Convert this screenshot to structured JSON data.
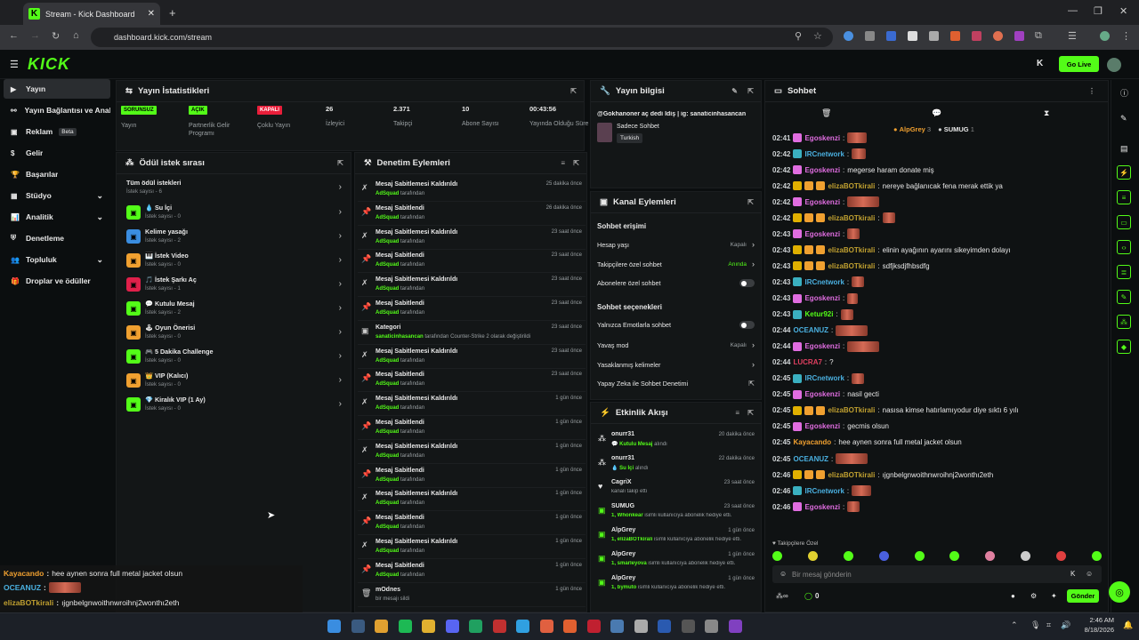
{
  "browser": {
    "tab_title": "Stream - Kick Dashboard",
    "url": "dashboard.kick.com/stream"
  },
  "brand": {
    "logo": "KICK",
    "accent": "#53fc18"
  },
  "topnav": {
    "go_live": "Go Live"
  },
  "sidebar": {
    "items": [
      {
        "label": "Yayın",
        "icon": "video-icon",
        "active": true
      },
      {
        "label": "Yayın Bağlantısı ve Anahtarı",
        "icon": "key-icon"
      },
      {
        "label": "Reklam",
        "icon": "ad-icon",
        "badge": "Beta"
      },
      {
        "label": "Gelir",
        "icon": "money-icon"
      },
      {
        "label": "Başarılar",
        "icon": "trophy-icon"
      },
      {
        "label": "Stüdyo",
        "icon": "studio-icon",
        "expand": true
      },
      {
        "label": "Analitik",
        "icon": "analytics-icon",
        "expand": true
      },
      {
        "label": "Denetleme",
        "icon": "shield-icon"
      },
      {
        "label": "Topluluk",
        "icon": "community-icon",
        "expand": true
      },
      {
        "label": "Droplar ve ödüller",
        "icon": "gift-icon"
      }
    ]
  },
  "stats": {
    "title": "Yayın İstatistikleri",
    "items": [
      {
        "value": "SORUNSUZ",
        "label": "Yayın",
        "kind": "badge-green"
      },
      {
        "value": "AÇIK",
        "label": "Partnerlik Gelir Programı",
        "kind": "badge-green"
      },
      {
        "value": "KAPALI",
        "label": "Çoklu Yayın",
        "kind": "badge-red"
      },
      {
        "value": "26",
        "label": "İzleyici"
      },
      {
        "value": "2.371",
        "label": "Takipçi"
      },
      {
        "value": "10",
        "label": "Abone Sayısı"
      },
      {
        "value": "00:43:56",
        "label": "Yayında Olduğu Süre"
      }
    ]
  },
  "rewards": {
    "title": "Ödül istek sırası",
    "items": [
      {
        "name": "Tüm ödül istekleri",
        "sub": "İstek sayısı - 6",
        "color": ""
      },
      {
        "name": "💧 Su İçi",
        "sub": "İstek sayısı - 0",
        "color": "#53fc18"
      },
      {
        "name": "Kelime yasağı",
        "sub": "İstek sayısı - 2",
        "color": "#3a8de0"
      },
      {
        "name": "🎹 İstek Video",
        "sub": "İstek sayısı - 0",
        "color": "#f0a030"
      },
      {
        "name": "🎵 İstek Şarkı Aç",
        "sub": "İstek sayısı - 1",
        "color": "#e0204a"
      },
      {
        "name": "💬 Kutulu Mesaj",
        "sub": "İstek sayısı - 2",
        "color": "#53fc18"
      },
      {
        "name": "🕹 Oyun Önerisi",
        "sub": "İstek sayısı - 0",
        "color": "#f0a030"
      },
      {
        "name": "🎮 5 Dakika Challenge",
        "sub": "İstek sayısı - 0",
        "color": "#53fc18"
      },
      {
        "name": "👑 VIP (Kalıcı)",
        "sub": "İstek sayısı - 0",
        "color": "#f0a030"
      },
      {
        "name": "💎 Kiralık VIP (1 Ay)",
        "sub": "İstek sayısı - 0",
        "color": "#53fc18"
      }
    ]
  },
  "moderation": {
    "title": "Denetim Eylemleri",
    "items": [
      {
        "title": "Mesaj Sabitlemesi Kaldırıldı",
        "actor": "AdSquad",
        "suffix": "tarafından",
        "time": "25 dakika önce",
        "icon": "unpin"
      },
      {
        "title": "Mesaj Sabitlendi",
        "actor": "AdSquad",
        "suffix": "tarafından",
        "time": "26 dakika önce",
        "icon": "pin"
      },
      {
        "title": "Mesaj Sabitlemesi Kaldırıldı",
        "actor": "AdSquad",
        "suffix": "tarafından",
        "time": "23 saat önce",
        "icon": "unpin"
      },
      {
        "title": "Mesaj Sabitlendi",
        "actor": "AdSquad",
        "suffix": "tarafından",
        "time": "23 saat önce",
        "icon": "pin"
      },
      {
        "title": "Mesaj Sabitlemesi Kaldırıldı",
        "actor": "AdSquad",
        "suffix": "tarafından",
        "time": "23 saat önce",
        "icon": "unpin"
      },
      {
        "title": "Mesaj Sabitlendi",
        "actor": "AdSquad",
        "suffix": "tarafından",
        "time": "23 saat önce",
        "icon": "pin"
      },
      {
        "title": "Kategori",
        "actor": "sanaticinhasancan",
        "suffix": "tarafından Counter-Strike 2 olarak değiştirildi",
        "time": "23 saat önce",
        "icon": "category"
      },
      {
        "title": "Mesaj Sabitlemesi Kaldırıldı",
        "actor": "AdSquad",
        "suffix": "tarafından",
        "time": "23 saat önce",
        "icon": "unpin"
      },
      {
        "title": "Mesaj Sabitlendi",
        "actor": "AdSquad",
        "suffix": "tarafından",
        "time": "23 saat önce",
        "icon": "pin"
      },
      {
        "title": "Mesaj Sabitlemesi Kaldırıldı",
        "actor": "AdSquad",
        "suffix": "tarafından",
        "time": "1 gün önce",
        "icon": "unpin"
      },
      {
        "title": "Mesaj Sabitlendi",
        "actor": "AdSquad",
        "suffix": "tarafından",
        "time": "1 gün önce",
        "icon": "pin"
      },
      {
        "title": "Mesaj Sabitlemesi Kaldırıldı",
        "actor": "AdSquad",
        "suffix": "tarafından",
        "time": "1 gün önce",
        "icon": "unpin"
      },
      {
        "title": "Mesaj Sabitlendi",
        "actor": "AdSquad",
        "suffix": "tarafından",
        "time": "1 gün önce",
        "icon": "pin"
      },
      {
        "title": "Mesaj Sabitlemesi Kaldırıldı",
        "actor": "AdSquad",
        "suffix": "tarafından",
        "time": "1 gün önce",
        "icon": "unpin"
      },
      {
        "title": "Mesaj Sabitlendi",
        "actor": "AdSquad",
        "suffix": "tarafından",
        "time": "1 gün önce",
        "icon": "pin"
      },
      {
        "title": "Mesaj Sabitlemesi Kaldırıldı",
        "actor": "AdSquad",
        "suffix": "tarafından",
        "time": "1 gün önce",
        "icon": "unpin"
      },
      {
        "title": "Mesaj Sabitlendi",
        "actor": "AdSquad",
        "suffix": "tarafından",
        "time": "1 gün önce",
        "icon": "pin"
      },
      {
        "title": "mOdnes",
        "actor": "",
        "suffix": "bir mesajı sildi",
        "time": "1 gün önce",
        "icon": "trash"
      }
    ]
  },
  "streaminfo": {
    "title": "Yayın bilgisi",
    "stream_title": "@Gokhanoner aç dedi İdiş | ig: sanaticinhasancan",
    "category": "Sadece Sohbet",
    "tag": "Turkish"
  },
  "channel": {
    "title": "Kanal Eylemleri",
    "sec1": "Sohbet erişimi",
    "rows1": [
      {
        "label": "Hesap yaşı",
        "value": "Kapalı",
        "kind": "chev"
      },
      {
        "label": "Takipçilere özel sohbet",
        "value": "Anında",
        "kind": "chev-green"
      },
      {
        "label": "Abonelere özel sohbet",
        "value": "",
        "kind": "toggle"
      }
    ],
    "sec2": "Sohbet seçenekleri",
    "rows2": [
      {
        "label": "Yalnızca Emotlarla sohbet",
        "value": "",
        "kind": "toggle"
      },
      {
        "label": "Yavaş mod",
        "value": "Kapalı",
        "kind": "chev"
      },
      {
        "label": "Yasaklanmış kelimeler",
        "value": "",
        "kind": "chev"
      },
      {
        "label": "Yapay Zeka ile Sohbet Denetimi",
        "value": "",
        "kind": "ext"
      }
    ]
  },
  "activity": {
    "title": "Etkinlik Akışı",
    "items": [
      {
        "user": "onurr31",
        "detail": "💬 Kutulu Mesaj",
        "detail2": "alındı",
        "time": "20 dakika önce",
        "icon": "reward"
      },
      {
        "user": "onurr31",
        "detail": "💧 Su İçi",
        "detail2": "alındı",
        "time": "22 dakika önce",
        "icon": "reward"
      },
      {
        "user": "CagriX",
        "detail": "",
        "detail2": "kanalı takip etti",
        "time": "23 saat önce",
        "icon": "heart"
      },
      {
        "user": "SUMUG",
        "detail": "1, Whonkear",
        "detail2": "isimli kullanıcıya abonelik hediye etti.",
        "time": "23 saat önce",
        "icon": "gift"
      },
      {
        "user": "AlpGrey",
        "detail": "1, elizaBOTkirali",
        "detail2": "isimli kullanıcıya abonelik hediye etti.",
        "time": "1 gün önce",
        "icon": "gift"
      },
      {
        "user": "AlpGrey",
        "detail": "1, smarleyova",
        "detail2": "isimli kullanıcıya abonelik hediye etti.",
        "time": "1 gün önce",
        "icon": "gift"
      },
      {
        "user": "AlpGrey",
        "detail": "1, bymuto",
        "detail2": "isimli kullanıcıya abonelik hediye etti.",
        "time": "1 gün önce",
        "icon": "gift"
      }
    ]
  },
  "chat": {
    "title": "Sohbet",
    "top_gifters": [
      {
        "name": "AlpGrey",
        "count": "3"
      },
      {
        "name": "SUMUG",
        "count": "1"
      }
    ],
    "messages": [
      {
        "time": "02:41",
        "user": "Egoskenzi",
        "color": "#e06de0",
        "text": "",
        "emote": 22,
        "badges": [
          "#e06de0"
        ]
      },
      {
        "time": "02:42",
        "user": "IRCnetwork",
        "color": "#4ab0e0",
        "text": "",
        "emote": 16,
        "badges": [
          "#3ab0c0"
        ]
      },
      {
        "time": "02:42",
        "user": "Egoskenzi",
        "color": "#e06de0",
        "text": "megerse haram donate miş",
        "emote": 0,
        "badges": [
          "#e06de0"
        ]
      },
      {
        "time": "02:42",
        "user": "elizaBOTkirali",
        "color": "#c0a030",
        "text": "nereye bağlanıcak fena merak ettik ya",
        "emote": 0,
        "badges": [
          "#e0b000",
          "#f0a030",
          "#f0a030"
        ]
      },
      {
        "time": "02:42",
        "user": "Egoskenzi",
        "color": "#e06de0",
        "text": "",
        "emote": 36,
        "badges": [
          "#e06de0"
        ]
      },
      {
        "time": "02:42",
        "user": "elizaBOTkirali",
        "color": "#c0a030",
        "text": "",
        "emote": 14,
        "badges": [
          "#e0b000",
          "#f0a030",
          "#f0a030"
        ]
      },
      {
        "time": "02:43",
        "user": "Egoskenzi",
        "color": "#e06de0",
        "text": "",
        "emote": 14,
        "badges": [
          "#e06de0"
        ]
      },
      {
        "time": "02:43",
        "user": "elizaBOTkirali",
        "color": "#c0a030",
        "text": "elinin ayağının ayarını sikeyimden dolayı",
        "emote": 0,
        "badges": [
          "#e0b000",
          "#f0a030",
          "#f0a030"
        ]
      },
      {
        "time": "02:43",
        "user": "elizaBOTkirali",
        "color": "#c0a030",
        "text": "sdfjksdjfhbsdfg",
        "emote": 0,
        "badges": [
          "#e0b000",
          "#f0a030",
          "#f0a030"
        ]
      },
      {
        "time": "02:43",
        "user": "IRCnetwork",
        "color": "#4ab0e0",
        "text": "",
        "emote": 14,
        "badges": [
          "#3ab0c0"
        ]
      },
      {
        "time": "02:43",
        "user": "Egoskenzi",
        "color": "#e06de0",
        "text": "",
        "emote": 12,
        "badges": [
          "#e06de0"
        ]
      },
      {
        "time": "02:43",
        "user": "Ketur92i",
        "color": "#53fc18",
        "text": "",
        "emote": 14,
        "badges": [
          "#3ab0c0"
        ]
      },
      {
        "time": "02:44",
        "user": "OCEANUZ",
        "color": "#4ab0e0",
        "text": "",
        "emote": 36,
        "badges": []
      },
      {
        "time": "02:44",
        "user": "Egoskenzi",
        "color": "#e06de0",
        "text": "",
        "emote": 36,
        "badges": [
          "#e06de0"
        ]
      },
      {
        "time": "02:44",
        "user": "LUCRA7",
        "color": "#e04060",
        "text": "?",
        "emote": 0,
        "badges": []
      },
      {
        "time": "02:45",
        "user": "IRCnetwork",
        "color": "#4ab0e0",
        "text": "",
        "emote": 14,
        "badges": [
          "#3ab0c0"
        ]
      },
      {
        "time": "02:45",
        "user": "Egoskenzi",
        "color": "#e06de0",
        "text": "nasil gecti",
        "emote": 0,
        "badges": [
          "#e06de0"
        ]
      },
      {
        "time": "02:45",
        "user": "elizaBOTkirali",
        "color": "#c0a030",
        "text": "nasısa kimse hatırlamıyodur diye sıktı 6 yılı",
        "emote": 0,
        "badges": [
          "#e0b000",
          "#f0a030",
          "#f0a030"
        ]
      },
      {
        "time": "02:45",
        "user": "Egoskenzi",
        "color": "#e06de0",
        "text": "gecmis olsun",
        "emote": 0,
        "badges": [
          "#e06de0"
        ]
      },
      {
        "time": "02:45",
        "user": "Kayacando",
        "color": "#f0a030",
        "text": "hee aynen sonra full metal jacket olsun",
        "emote": 0,
        "badges": []
      },
      {
        "time": "02:45",
        "user": "OCEANUZ",
        "color": "#4ab0e0",
        "text": "",
        "emote": 36,
        "badges": []
      },
      {
        "time": "02:46",
        "user": "elizaBOTkirali",
        "color": "#c0a030",
        "text": "ıjgnbelgnwoithnwroihnj2wonthı2eth",
        "emote": 0,
        "badges": [
          "#e0b000",
          "#f0a030",
          "#f0a030"
        ]
      },
      {
        "time": "02:46",
        "user": "IRCnetwork",
        "color": "#4ab0e0",
        "text": "",
        "emote": 22,
        "badges": [
          "#3ab0c0"
        ]
      },
      {
        "time": "02:46",
        "user": "Egoskenzi",
        "color": "#e06de0",
        "text": "",
        "emote": 14,
        "badges": [
          "#e06de0"
        ]
      }
    ],
    "followers_only": "Takipçilere Özel",
    "placeholder": "Bir mesaj gönderin",
    "send": "Gönder",
    "viewers": "0"
  },
  "overlay": [
    {
      "user": "Kayacando",
      "color": "#f0a030",
      "text": "hee aynen sonra full metal jacket olsun",
      "emote": 0
    },
    {
      "user": "OCEANUZ",
      "color": "#4ab0e0",
      "text": "",
      "emote": 36
    },
    {
      "user": "elizaBOTkirali",
      "color": "#c0a030",
      "text": "ıjgnbelgnwoithnwroihnj2wonthı2eth",
      "emote": 0
    },
    {
      "user": "IRCnetwork",
      "color": "#4ab0e0",
      "text": "",
      "emote": 22
    },
    {
      "user": "Egoskenzi",
      "color": "#e06de0",
      "text": "",
      "emote": 10
    }
  ],
  "taskbar": {
    "time": "2:46 AM",
    "date": "8/18/2026"
  }
}
